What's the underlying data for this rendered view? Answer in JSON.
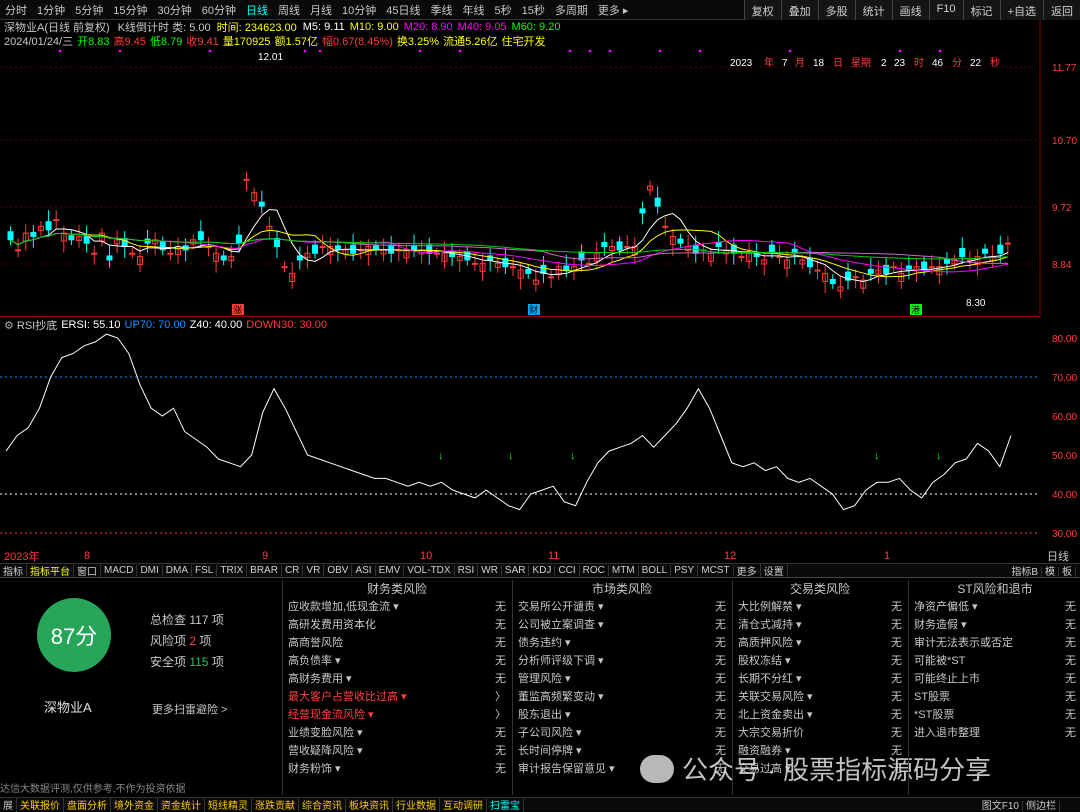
{
  "period_tabs": [
    "分时",
    "1分钟",
    "5分钟",
    "15分钟",
    "30分钟",
    "60分钟",
    "日线",
    "周线",
    "月线",
    "10分钟",
    "45日线",
    "季线",
    "年线",
    "5秒",
    "15秒",
    "多周期",
    "更多 ▸"
  ],
  "period_active": 6,
  "toolbar_right": [
    "复权",
    "叠加",
    "多股",
    "统计",
    "画线",
    "F10",
    "标记",
    "+自选",
    "返回"
  ],
  "kline": {
    "title": "深物业A(日线 前复权)",
    "indicator": "K线倒计时 类: 5.00",
    "time_label": "时间: 234623.00",
    "ma": [
      {
        "t": "M5: 9.11",
        "c": "#ffffff"
      },
      {
        "t": "M10: 9.00",
        "c": "#ffff00"
      },
      {
        "t": "M20: 8.90",
        "c": "#ff00ff"
      },
      {
        "t": "M40: 9.05",
        "c": "#ff00ff"
      },
      {
        "t": "M60: 9.20",
        "c": "#00ff00"
      }
    ],
    "line2": [
      {
        "t": "2024/01/24/三",
        "c": "#c8c8c8"
      },
      {
        "t": "开8.83",
        "c": "#00ff00"
      },
      {
        "t": "高9.45",
        "c": "#ff3b3b"
      },
      {
        "t": "低8.79",
        "c": "#00ff00"
      },
      {
        "t": "收9.41",
        "c": "#ff3b3b"
      },
      {
        "t": "量170925",
        "c": "#ffff00"
      },
      {
        "t": "额1.57亿",
        "c": "#ffff00"
      },
      {
        "t": "幅0.67(8.45%)",
        "c": "#ff3b3b"
      },
      {
        "t": "换3.25%",
        "c": "#ffff00"
      },
      {
        "t": "流通5.26亿",
        "c": "#ffff00"
      },
      {
        "t": "住宅开发",
        "c": "#ffff00"
      }
    ],
    "y_ticks": [
      "11.77",
      "10.70",
      "9.72",
      "8.84"
    ],
    "max_label": "12.01",
    "min_label": "8.30",
    "clock": [
      {
        "t": "2023",
        "c": "#ffffff"
      },
      {
        "t": "年",
        "c": "#ff3b3b"
      },
      {
        "t": "7",
        "c": "#ffffff"
      },
      {
        "t": "月",
        "c": "#ff3b3b"
      },
      {
        "t": "18",
        "c": "#ffffff"
      },
      {
        "t": "日",
        "c": "#ff3b3b"
      },
      {
        "t": "星期",
        "c": "#ff3b3b"
      },
      {
        "t": "2",
        "c": "#ffffff"
      },
      {
        "t": "23",
        "c": "#ffffff"
      },
      {
        "t": "时",
        "c": "#ff3b3b"
      },
      {
        "t": "46",
        "c": "#ffffff"
      },
      {
        "t": "分",
        "c": "#ff3b3b"
      },
      {
        "t": "22",
        "c": "#ffffff"
      },
      {
        "t": "秒",
        "c": "#ff3b3b"
      }
    ],
    "markers": [
      {
        "t": "涨",
        "c": "#ff3b3b"
      },
      {
        "t": "财",
        "c": "#00aaff"
      },
      {
        "t": "港",
        "c": "#00ff00"
      }
    ]
  },
  "rsi": {
    "title": "RSI抄底",
    "ersi": "ERSI: 55.10",
    "up": "UP70: 70.00",
    "z": "Z40: 40.00",
    "down": "DOWN30: 30.00",
    "y_ticks": [
      "80.00",
      "70.00",
      "60.00",
      "50.00",
      "40.00",
      "30.00"
    ]
  },
  "date_axis": [
    "2023年",
    "8",
    "9",
    "10",
    "11",
    "12",
    "1",
    "日线"
  ],
  "indicator_tabs": [
    "指标",
    "指标平台",
    "窗口",
    "MACD",
    "DMI",
    "DMA",
    "FSL",
    "TRIX",
    "BRAR",
    "CR",
    "VR",
    "OBV",
    "ASI",
    "EMV",
    "VOL-TDX",
    "RSI",
    "WR",
    "SAR",
    "KDJ",
    "CCI",
    "ROC",
    "MTM",
    "BOLL",
    "PSY",
    "MCST",
    "更多",
    "设置"
  ],
  "indicator_right": [
    "指标B",
    "模",
    "板"
  ],
  "scan": {
    "score": "87分",
    "stock": "深物业A",
    "stats": [
      {
        "k": "总检查",
        "v": "117",
        "u": "项",
        "c": "#c8c8c8"
      },
      {
        "k": "风险项",
        "v": "2",
        "u": "项",
        "c": "#ff4040"
      },
      {
        "k": "安全项",
        "v": "115",
        "u": "项",
        "c": "#27c060"
      }
    ],
    "more": "更多扫雷避险 >",
    "disclaimer": "达信大数据评测,仅供参考,不作为投资依据",
    "cols": [
      {
        "title": "财务类风险",
        "rows": [
          [
            "应收款增加,低现金流 ▾",
            "无",
            0
          ],
          [
            "高研发费用资本化",
            "无",
            0
          ],
          [
            "高商誉风险",
            "无",
            0
          ],
          [
            "高负债率 ▾",
            "无",
            0
          ],
          [
            "高财务费用 ▾",
            "无",
            0
          ],
          [
            "最大客户占营收比过高 ▾",
            "〉",
            1
          ],
          [
            "经营现金流风险 ▾",
            "〉",
            1
          ],
          [
            "业绩变脸风险 ▾",
            "无",
            0
          ],
          [
            "营收疑降风险 ▾",
            "无",
            0
          ],
          [
            "财务粉饰 ▾",
            "无",
            0
          ]
        ]
      },
      {
        "title": "市场类风险",
        "rows": [
          [
            "交易所公开谴责 ▾",
            "无",
            0
          ],
          [
            "公司被立案调查 ▾",
            "无",
            0
          ],
          [
            "债务违约 ▾",
            "无",
            0
          ],
          [
            "分析师评级下调 ▾",
            "无",
            0
          ],
          [
            "管理风险 ▾",
            "无",
            0
          ],
          [
            "董监高频繁变动 ▾",
            "无",
            0
          ],
          [
            "股东退出 ▾",
            "无",
            0
          ],
          [
            "子公司风险 ▾",
            "无",
            0
          ],
          [
            "长时间停牌 ▾",
            "无",
            0
          ],
          [
            "审计报告保留意见 ▾",
            "无",
            0
          ]
        ]
      },
      {
        "title": "交易类风险",
        "rows": [
          [
            "大比例解禁 ▾",
            "无",
            0
          ],
          [
            "清仓式减持 ▾",
            "无",
            0
          ],
          [
            "高质押风险 ▾",
            "无",
            0
          ],
          [
            "股权冻结 ▾",
            "无",
            0
          ],
          [
            "长期不分红 ▾",
            "无",
            0
          ],
          [
            "关联交易风险 ▾",
            "无",
            0
          ],
          [
            "北上资金卖出 ▾",
            "无",
            0
          ],
          [
            "大宗交易折价",
            "无",
            0
          ],
          [
            "融资融券 ▾",
            "无",
            0
          ],
          [
            "交易过高 ▾",
            "无",
            0
          ]
        ]
      },
      {
        "title": "ST风险和退市",
        "rows": [
          [
            "净资产偏低 ▾",
            "无",
            0
          ],
          [
            "财务造假 ▾",
            "无",
            0
          ],
          [
            "审计无法表示或否定",
            "无",
            0
          ],
          [
            "可能被*ST",
            "无",
            0
          ],
          [
            "可能终止上市",
            "无",
            0
          ],
          [
            "ST股票",
            "无",
            0
          ],
          [
            "*ST股票",
            "无",
            0
          ],
          [
            "进入退市整理",
            "无",
            0
          ]
        ]
      }
    ]
  },
  "watermark": "公众号 · 股票指标源码分享",
  "bottom_tabs": [
    "关联报价",
    "盘面分析",
    "境外资金",
    "资金统计",
    "短线精灵",
    "涨跌贡献",
    "综合资讯",
    "板块资讯",
    "行业数据",
    "互动调研",
    "扫雷宝"
  ],
  "bottom_left": "展",
  "bottom_right": [
    "图文F10",
    "侧边栏"
  ],
  "colors": {
    "up": "#ff3b3b",
    "down": "#00ffff"
  }
}
